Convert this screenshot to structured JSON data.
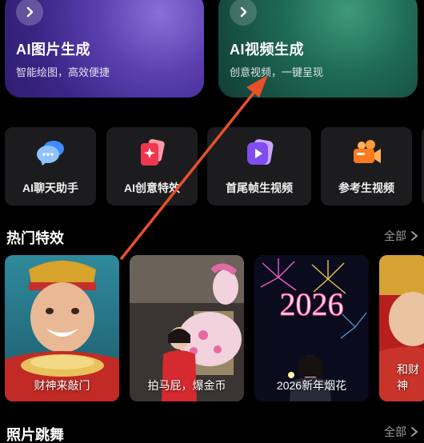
{
  "features": [
    {
      "title": "AI图片生成",
      "subtitle": "智能绘图，高效便捷"
    },
    {
      "title": "AI视频生成",
      "subtitle": "创意视频，一键呈现"
    }
  ],
  "tools": [
    {
      "label": "AI聊天助手",
      "icon": "chat-bubble-icon"
    },
    {
      "label": "AI创意特效",
      "icon": "sparkle-card-icon"
    },
    {
      "label": "首尾帧生视频",
      "icon": "play-icon"
    },
    {
      "label": "参考生视频",
      "icon": "video-camera-icon"
    }
  ],
  "sections": {
    "hot": {
      "title": "热门特效",
      "see_all": "全部"
    },
    "dance": {
      "title": "照片跳舞",
      "see_all": "全部"
    }
  },
  "effects": [
    {
      "caption": "财神来敲门"
    },
    {
      "caption": "拍马屁，爆金币"
    },
    {
      "caption": "2026新年烟花",
      "image_text": "2026"
    },
    {
      "caption": "和财神"
    }
  ],
  "colors": {
    "background": "#000000",
    "tile": "#1c1c1e",
    "image_card": "#3a2585",
    "video_card": "#1f6b55",
    "arrow": "#e8502a",
    "muted_text": "#9a9a9a"
  }
}
